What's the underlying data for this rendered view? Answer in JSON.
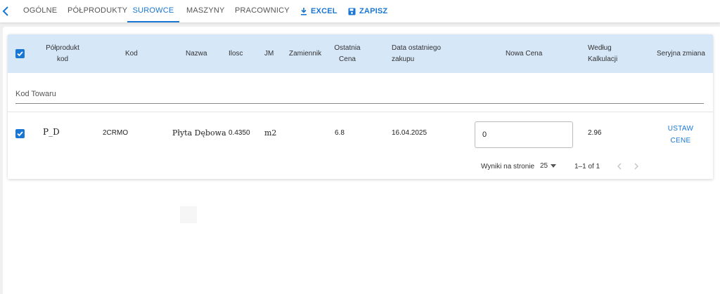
{
  "tabs": [
    {
      "label": "OGÓLNE"
    },
    {
      "label": "PÓŁPRODUKTY"
    },
    {
      "label": "SUROWCE"
    },
    {
      "label": "MASZYNY"
    },
    {
      "label": "PRACOWNICY"
    }
  ],
  "actions": {
    "excel": "EXCEL",
    "save": "ZAPISZ"
  },
  "table": {
    "headers": {
      "polprodukt_kod": [
        "Półprodukt",
        "kod"
      ],
      "kod": "Kod",
      "nazwa": "Nazwa",
      "ilosc": "Ilosc",
      "jm": "JM",
      "zamiennik": "Zamiennik",
      "ostatnia_cena": [
        "Ostatnia",
        "Cena"
      ],
      "data_zakupu": [
        "Data ostatniego",
        "zakupu"
      ],
      "nowa_cena": "Nowa Cena",
      "wedlug_kalkulacji": [
        "Według",
        "Kalkulacji"
      ],
      "seryjna_zmiana": "Seryjna zmiana"
    },
    "filter_placeholder": "Kod Towaru",
    "rows": [
      {
        "polprodukt_kod": "P_D",
        "kod": "2CRMO",
        "nazwa": "Płyta Dębowa",
        "ilosc": "0.4350",
        "jm": "m2",
        "zamiennik": "",
        "ostatnia_cena": "6.8",
        "data_zakupu": "16.04.2025",
        "nowa_cena": "0",
        "wedlug_kalkulacji": "2.96",
        "action_label": [
          "USTAW",
          "CENE"
        ]
      }
    ]
  },
  "pagination": {
    "per_page_label": "Wyniki na stronie",
    "per_page_value": "25",
    "range": "1–1 of 1"
  },
  "colors": {
    "accent": "#1976d2",
    "header_bg": "#d6e7f8"
  }
}
